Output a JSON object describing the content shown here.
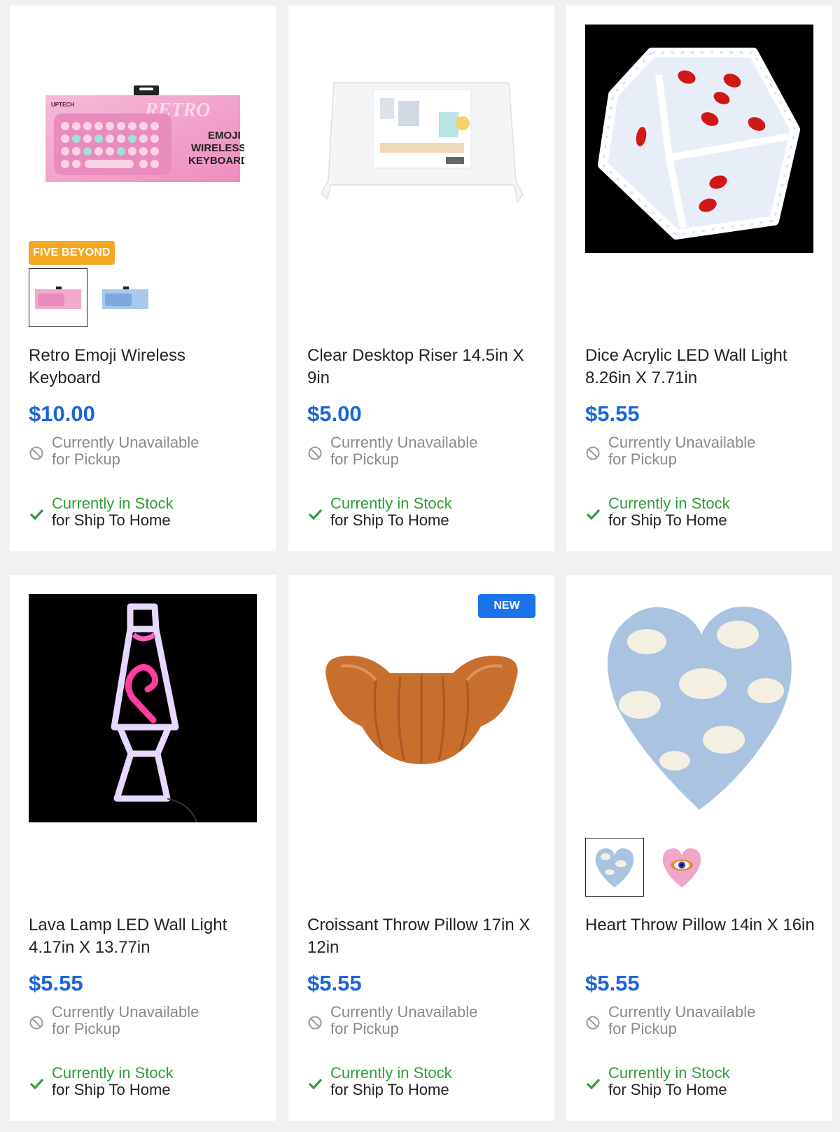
{
  "products": [
    {
      "title": "Retro Emoji Wireless Keyboard",
      "price": "$10.00",
      "badge": "FIVE BEYOND",
      "thumbnails": [
        "pink-keyboard",
        "blue-keyboard"
      ],
      "pickup_line1": "Currently Unavailable",
      "pickup_line2": "for Pickup",
      "ship_line1": "Currently in Stock",
      "ship_line2": "for Ship To Home"
    },
    {
      "title": "Clear Desktop Riser 14.5in X 9in",
      "price": "$5.00",
      "pickup_line1": "Currently Unavailable",
      "pickup_line2": "for Pickup",
      "ship_line1": "Currently in Stock",
      "ship_line2": "for Ship To Home"
    },
    {
      "title": "Dice Acrylic LED Wall Light 8.26in X 7.71in",
      "price": "$5.55",
      "pickup_line1": "Currently Unavailable",
      "pickup_line2": "for Pickup",
      "ship_line1": "Currently in Stock",
      "ship_line2": "for Ship To Home"
    },
    {
      "title": "Lava Lamp LED Wall Light 4.17in X 13.77in",
      "price": "$5.55",
      "pickup_line1": "Currently Unavailable",
      "pickup_line2": "for Pickup",
      "ship_line1": "Currently in Stock",
      "ship_line2": "for Ship To Home"
    },
    {
      "title": "Croissant Throw Pillow 17in X 12in",
      "price": "$5.55",
      "badge_new": "NEW",
      "pickup_line1": "Currently Unavailable",
      "pickup_line2": "for Pickup",
      "ship_line1": "Currently in Stock",
      "ship_line2": "for Ship To Home"
    },
    {
      "title": "Heart Throw Pillow 14in X 16in",
      "price": "$5.55",
      "thumbnails": [
        "cloud-heart",
        "eye-heart"
      ],
      "pickup_line1": "Currently Unavailable",
      "pickup_line2": "for Pickup",
      "ship_line1": "Currently in Stock",
      "ship_line2": "for Ship To Home"
    }
  ],
  "colors": {
    "price": "#1a66d6",
    "in_stock": "#2e9e3a",
    "unavailable": "#8a8a8a",
    "badge_brand": "#f5a623",
    "badge_new": "#1a73e8"
  },
  "icons": {
    "pickup": "unavailable-circle-icon",
    "ship": "checkmark-icon"
  },
  "keyboard_box": {
    "brand": "UPTECH",
    "logo": "RETRO",
    "caption_line1": "EMOJI",
    "caption_line2": "WIRELESS",
    "caption_line3": "KEYBOARD"
  }
}
